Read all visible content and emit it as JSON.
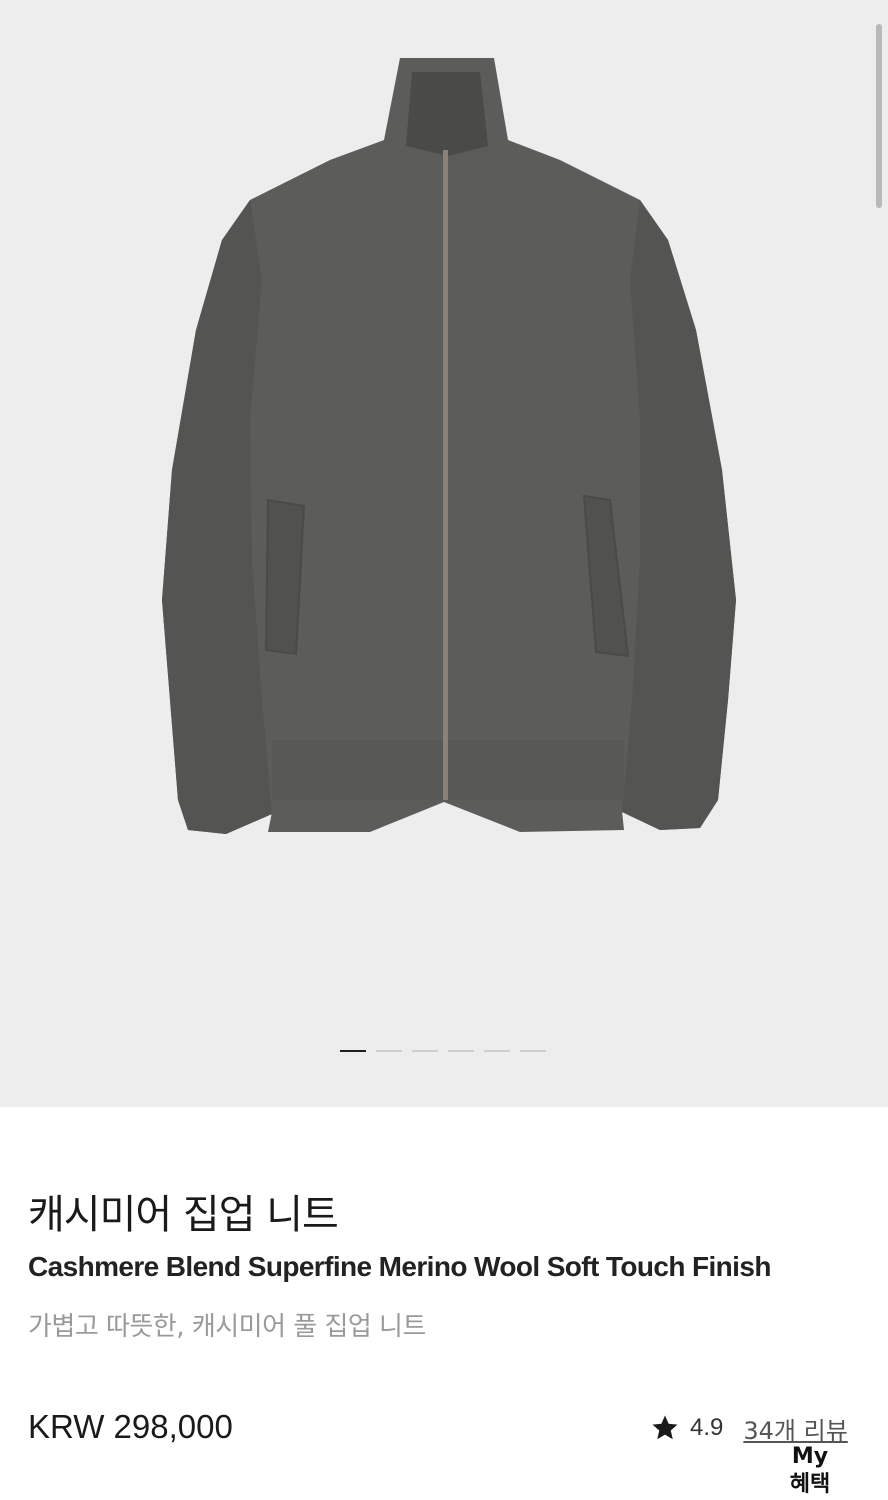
{
  "gallery": {
    "image_alt": "cashmere zip-up knit jacket, charcoal grey",
    "image_icon": "jacket-photo",
    "colors": {
      "background": "#ededed",
      "knit": "#5c5c5b",
      "zipper": "#8a8178"
    },
    "slide_count": 6,
    "active_slide": 1
  },
  "product": {
    "title_ko": "캐시미어 집업 니트",
    "title_en": "Cashmere Blend Superfine Merino Wool Soft Touch Finish",
    "subtitle": "가볍고 따뜻한, 캐시미어 풀 집업 니트",
    "price": "KRW 298,000"
  },
  "rating": {
    "icon": "star-icon",
    "value": "4.9",
    "reviews_label": "34개 리뷰"
  },
  "floating_button": {
    "line1": "My",
    "line2": "혜택"
  }
}
